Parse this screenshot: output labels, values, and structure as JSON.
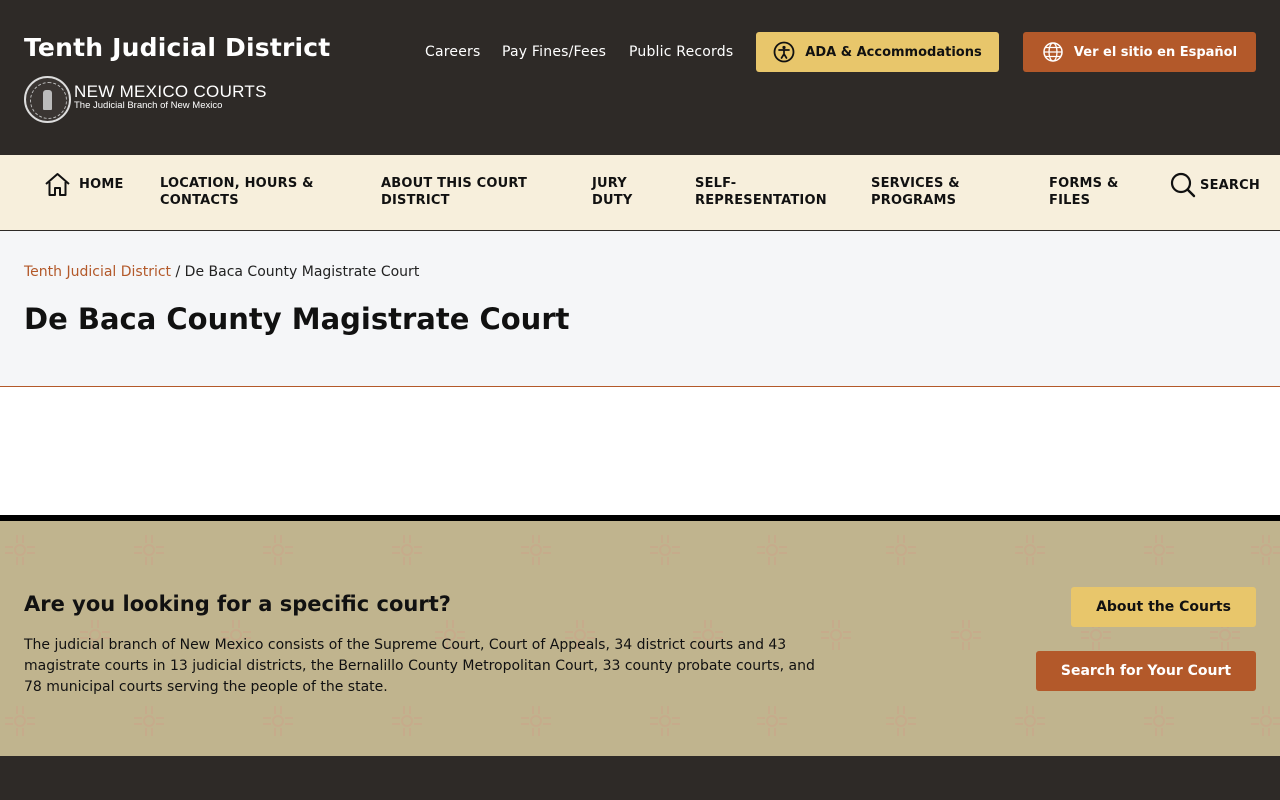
{
  "header": {
    "site_title": "Tenth Judicial District",
    "logo_main": "NEW MEXICO COURTS",
    "logo_sub": "The Judicial Branch of New Mexico",
    "links": {
      "careers": "Careers",
      "pay_fines": "Pay Fines/Fees",
      "public_records": "Public Records"
    },
    "ada_button": "ADA & Accommodations",
    "spanish_button": "Ver el sitio en Español",
    "colors": {
      "background": "#2e2a27",
      "ada": "#e8c66b",
      "spanish": "#b3592a"
    }
  },
  "nav": {
    "home": "HOME",
    "location_line1": "LOCATION, HOURS &",
    "location_line2": "CONTACTS",
    "about_line1": "ABOUT THIS COURT",
    "about_line2": "DISTRICT",
    "jury_line1": "JURY",
    "jury_line2": "DUTY",
    "self_line1": "SELF-",
    "self_line2": "REPRESENTATION",
    "services_line1": "SERVICES &",
    "services_line2": "PROGRAMS",
    "forms_line1": "FORMS &",
    "forms_line2": "FILES",
    "search": "SEARCH"
  },
  "breadcrumb": {
    "parent": "Tenth Judicial District",
    "separator": " / ",
    "current": "De Baca County Magistrate Court"
  },
  "page": {
    "title": "De Baca County Magistrate Court"
  },
  "court_finder": {
    "title": "Are you looking for a specific court?",
    "description": "The judicial branch of New Mexico consists of the Supreme Court, Court of Appeals, 34 district courts and 43 magistrate courts in 13 judicial districts, the Bernalillo County Metropolitan Court, 33 county probate courts, and 78 municipal courts serving the people of the state.",
    "about_button": "About the Courts",
    "search_button": "Search for Your Court",
    "background_color": "#c0b48e"
  }
}
